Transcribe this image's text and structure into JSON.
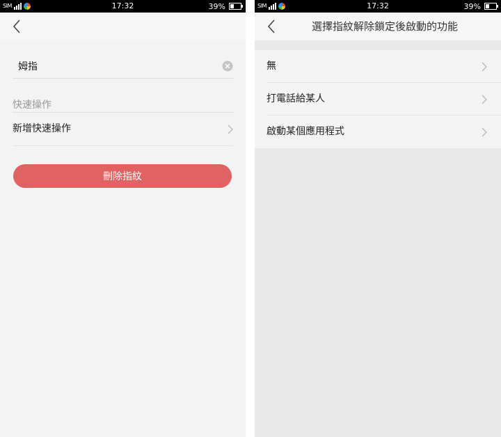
{
  "status_bar": {
    "sim_label": "SIM",
    "time": "17:32",
    "battery": "39%",
    "battery_level": 0.39
  },
  "left_screen": {
    "back_icon": "chevron-left-icon",
    "name_field": {
      "value": "姆指"
    },
    "clear_icon": "clear-circle-icon",
    "section_label": "快速操作",
    "add_quick_action_label": "新增快速操作",
    "delete_button_label": "刪除指紋",
    "colors": {
      "delete_button": "#e06262",
      "background": "#f3f3f3"
    }
  },
  "right_screen": {
    "title": "選擇指紋解除鎖定後啟動的功能",
    "back_icon": "chevron-left-icon",
    "options": [
      {
        "label": "無"
      },
      {
        "label": "打電話給某人"
      },
      {
        "label": "啟動某個應用程式"
      }
    ],
    "colors": {
      "background": "#e9e9e9",
      "list": "#f4f4f4"
    }
  }
}
